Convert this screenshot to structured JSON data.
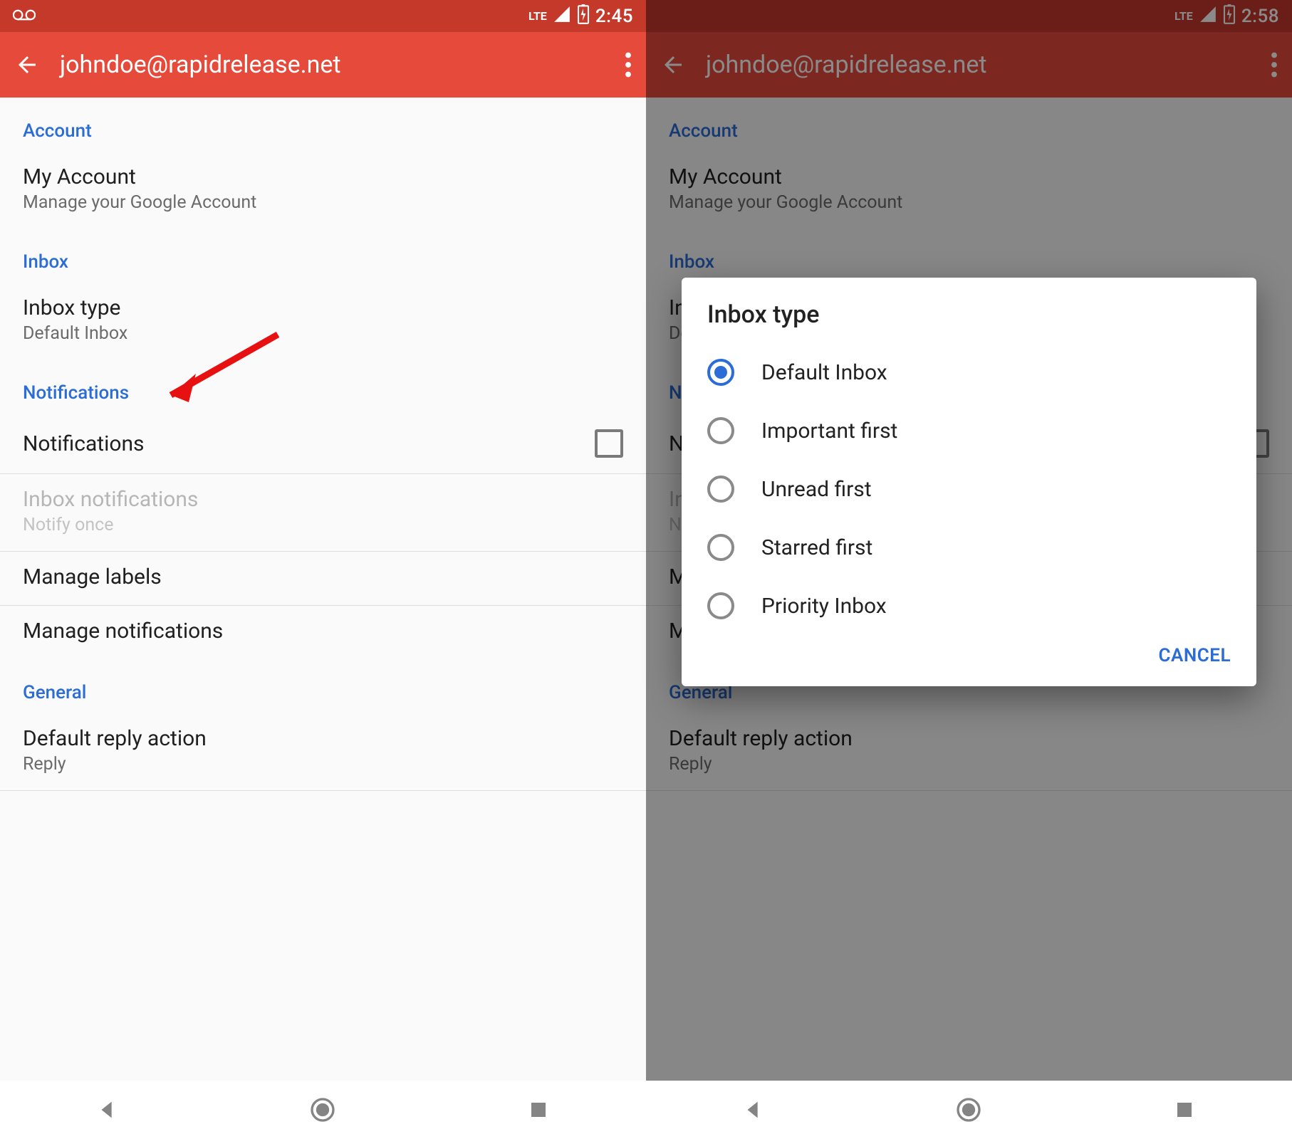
{
  "left": {
    "statusbar": {
      "time": "2:45",
      "lte": "LTE"
    },
    "appbar": {
      "title": "johndoe@rapidrelease.net"
    },
    "sections": {
      "account": {
        "header": "Account",
        "myaccount_title": "My Account",
        "myaccount_sub": "Manage your Google Account"
      },
      "inbox": {
        "header": "Inbox",
        "type_title": "Inbox type",
        "type_sub": "Default Inbox"
      },
      "notifications": {
        "header": "Notifications",
        "notifications_title": "Notifications",
        "inbox_notif_title": "Inbox notifications",
        "inbox_notif_sub": "Notify once",
        "manage_labels": "Manage labels",
        "manage_notifications": "Manage notifications"
      },
      "general": {
        "header": "General",
        "reply_title": "Default reply action",
        "reply_sub": "Reply"
      }
    }
  },
  "right": {
    "statusbar": {
      "time": "2:58",
      "lte": "LTE"
    },
    "appbar": {
      "title": "johndoe@rapidrelease.net"
    },
    "sections": {
      "account": {
        "header": "Account",
        "myaccount_title": "My Account",
        "myaccount_sub": "Manage your Google Account"
      },
      "inbox": {
        "header": "Inbox",
        "type_title": "Inbox type",
        "type_sub": "Default Inbox"
      },
      "notifications": {
        "header": "Notifications",
        "notifications_title": "Notifications",
        "inbox_notif_title": "Inbox notifications",
        "inbox_notif_sub": "Notify once",
        "manage_labels": "Manage labels",
        "manage_notifications": "Manage notifications"
      },
      "general": {
        "header": "General",
        "reply_title": "Default reply action",
        "reply_sub": "Reply"
      }
    },
    "dialog": {
      "title": "Inbox type",
      "options": [
        "Default Inbox",
        "Important first",
        "Unread first",
        "Starred first",
        "Priority Inbox"
      ],
      "selected_index": 0,
      "cancel": "CANCEL"
    }
  }
}
